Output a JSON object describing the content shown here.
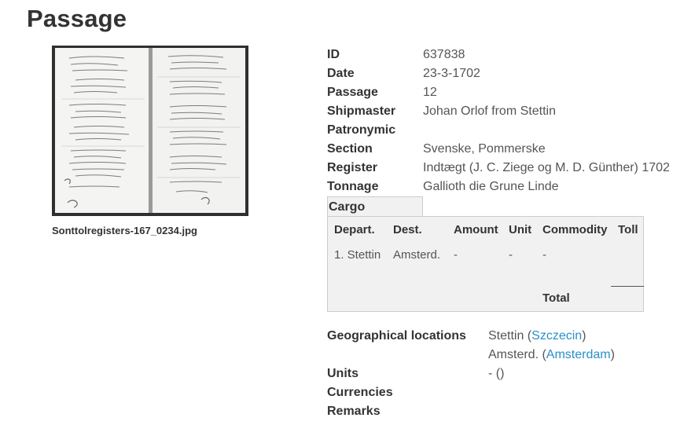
{
  "page": {
    "title": "Passage"
  },
  "image": {
    "filename": "Sonttolregisters-167_0234.jpg"
  },
  "passage": [
    {
      "key": "ID",
      "value": "637838"
    },
    {
      "key": "Date",
      "value": "23-3-1702"
    },
    {
      "key": "Passage",
      "value": "12"
    },
    {
      "key": "Shipmaster",
      "value": "Johan Orlof from Stettin"
    },
    {
      "key": "Patronymic",
      "value": ""
    },
    {
      "key": "Section",
      "value": "Svenske, Pommerske"
    },
    {
      "key": "Register",
      "value": "Indtægt (J. C. Ziege og M. D. Günther) 1702"
    },
    {
      "key": "Tonnage",
      "value": "Gallioth die Grune Linde"
    }
  ],
  "cargo": {
    "tab_label": "Cargo",
    "headers": {
      "depart": "Depart.",
      "dest": "Dest.",
      "amount": "Amount",
      "unit": "Unit",
      "commodity": "Commodity",
      "toll": "Toll"
    },
    "rows": [
      {
        "depart": "1. Stettin",
        "dest": "Amsterd.",
        "amount": "-",
        "unit": "-",
        "commodity": "-"
      }
    ],
    "total_label": "Total"
  },
  "geo": {
    "label": "Geographical locations",
    "locations": [
      {
        "name": "Stettin",
        "link": "Szczecin"
      },
      {
        "name": "Amsterd.",
        "link": "Amsterdam"
      }
    ],
    "units_label": "Units",
    "units_value": "- ()",
    "currencies_label": "Currencies",
    "remarks_label": "Remarks"
  },
  "colors": {
    "link": "#2a8fc7",
    "panel_bg": "#f1f1f1",
    "panel_border": "#cccccc"
  }
}
